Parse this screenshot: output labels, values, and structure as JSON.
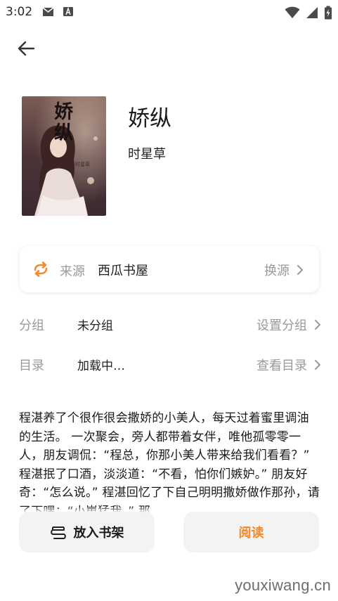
{
  "status_bar": {
    "time": "3:02",
    "icons": [
      "gmail-icon",
      "notification-a-icon",
      "wifi-icon",
      "cell-signal-icon",
      "battery-charging-icon"
    ]
  },
  "book": {
    "title": "娇纵",
    "author": "时星草",
    "cover_title_art": "娇纵",
    "cover_author_art": "时星草"
  },
  "source": {
    "label": "来源",
    "value": "西瓜书屋",
    "action": "换源"
  },
  "group": {
    "label": "分组",
    "value": "未分组",
    "action": "设置分组"
  },
  "catalog": {
    "label": "目录",
    "value": "加载中…",
    "action": "查看目录"
  },
  "summary": "程湛养了个很作很会撒娇的小美人，每天过着蜜里调油的生活。 一次聚会，旁人都带着女伴，唯他孤零零一人，朋友调侃：“程总，你那小美人带来给我们看看？” 程湛抿了口酒，淡淡道：“不看，怕你们嫉妒。” 朋友好奇：“怎么说。” 程湛回忆了下自己明明撒娇做作那孙，请了下嘿：“小崽猛我。” 那",
  "buttons": {
    "add_shelf": "放入书架",
    "read": "阅读"
  },
  "watermark": "youxiwang.cn",
  "colors": {
    "accent": "#f08a2c",
    "muted": "#9a9a9a",
    "button_bg": "#f3f3f3"
  }
}
